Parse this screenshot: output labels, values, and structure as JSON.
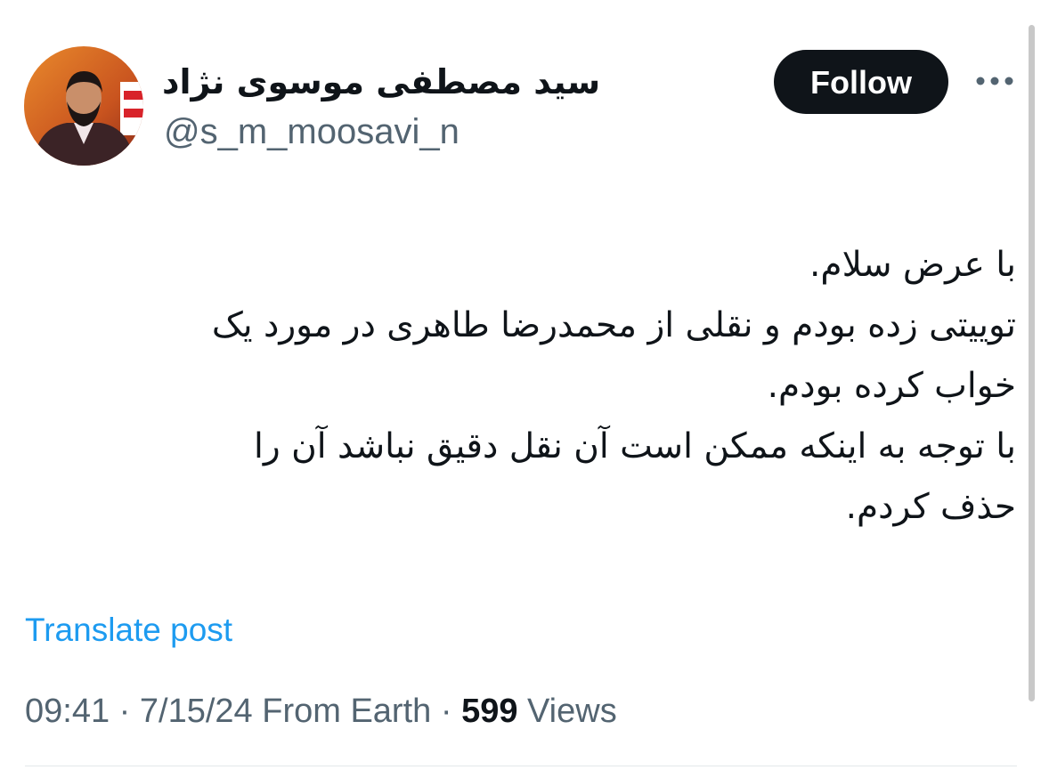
{
  "author": {
    "display_name": "سید مصطفی موسوی نژاد",
    "handle": "@s_m_moosavi_n",
    "avatar_icon": "profile-photo"
  },
  "actions": {
    "follow_label": "Follow",
    "more_icon": "more-horizontal-icon"
  },
  "tweet": {
    "lines": [
      "با عرض سلام.",
      "توییتی زده بودم و نقلی از محمدرضا طاهری در مورد یک",
      "خواب کرده بودم.",
      "با توجه به اینکه ممکن است آن نقل دقیق نباشد آن را",
      "حذف کردم."
    ],
    "translate_label": "Translate post"
  },
  "meta": {
    "time": "09:41",
    "separator1": " · ",
    "date": "7/15/24",
    "source": " From Earth",
    "separator2": " · ",
    "views_count": "599",
    "views_label": " Views"
  },
  "colors": {
    "text_primary": "#0f1419",
    "text_secondary": "#536471",
    "link": "#1d9bf0",
    "follow_bg": "#0f1419"
  }
}
